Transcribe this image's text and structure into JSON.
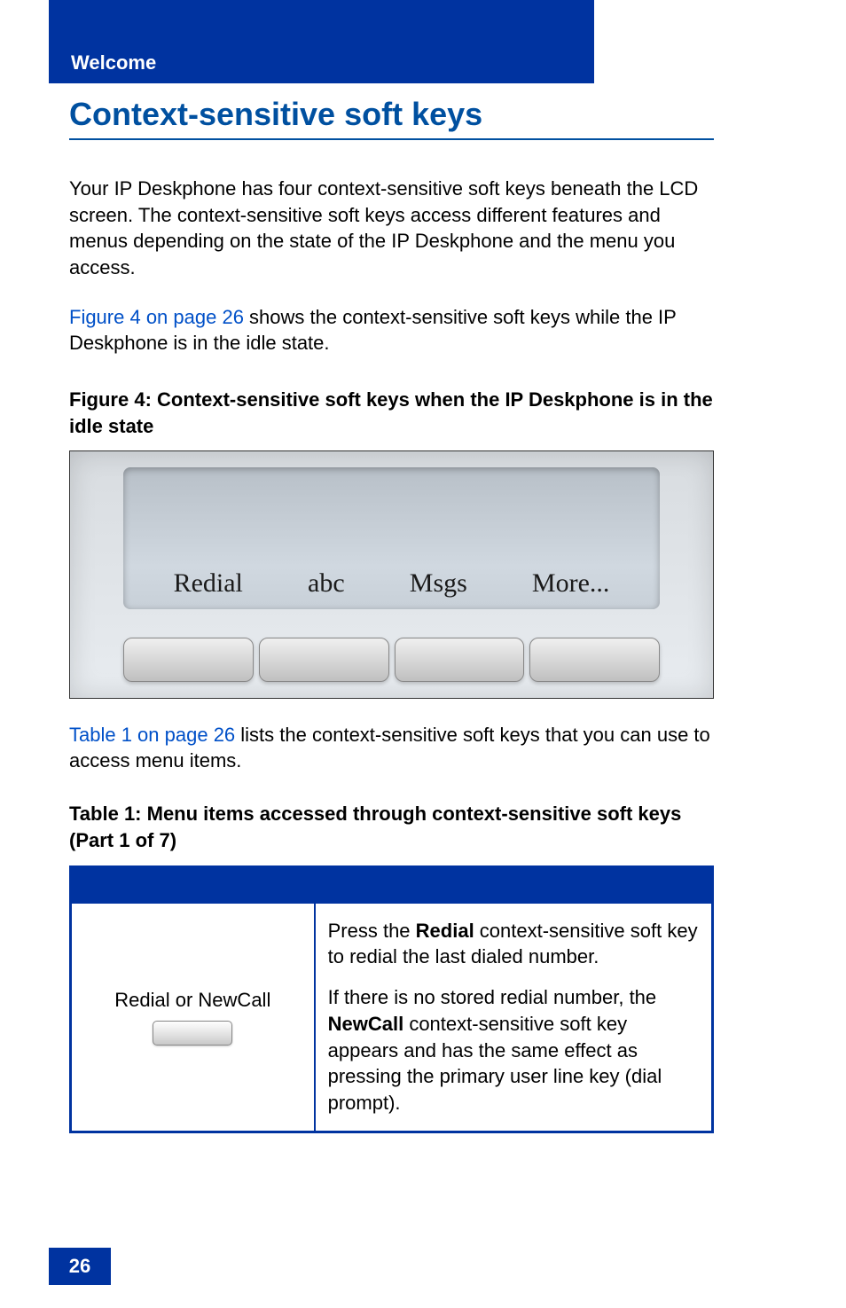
{
  "header": {
    "tab_label": "Welcome"
  },
  "heading": "Context-sensitive soft keys",
  "paragraphs": {
    "intro": "Your IP Deskphone has four context-sensitive soft keys beneath the LCD screen. The context-sensitive soft keys access different features and menus depending on the state of the IP Deskphone and the menu you access.",
    "fig_ref_link": "Figure 4 on page 26",
    "fig_ref_rest": " shows the context-sensitive soft keys while the IP Deskphone is in the idle state.",
    "figure_caption": "Figure 4:  Context-sensitive soft keys when the IP Deskphone is in the idle state",
    "table_ref_link": "Table 1 on page 26",
    "table_ref_rest": " lists the context-sensitive soft keys that you can use to access menu items.",
    "table_caption": "Table 1: Menu items accessed through context-sensitive soft keys (Part 1 of 7)"
  },
  "softkeys": {
    "k1": "Redial",
    "k2": "abc",
    "k3": "Msgs",
    "k4": "More..."
  },
  "table": {
    "row1": {
      "left_label": "Redial or NewCall",
      "right_p1_a": "Press the ",
      "right_p1_b_bold": "Redial",
      "right_p1_c": " context-sensitive soft key to redial the last dialed number.",
      "right_p2_a": "If there is no stored redial number, the ",
      "right_p2_b_bold": "NewCall",
      "right_p2_c": " context-sensitive soft key appears and has the same effect as pressing the primary user line key (dial prompt)."
    }
  },
  "page_number": "26"
}
